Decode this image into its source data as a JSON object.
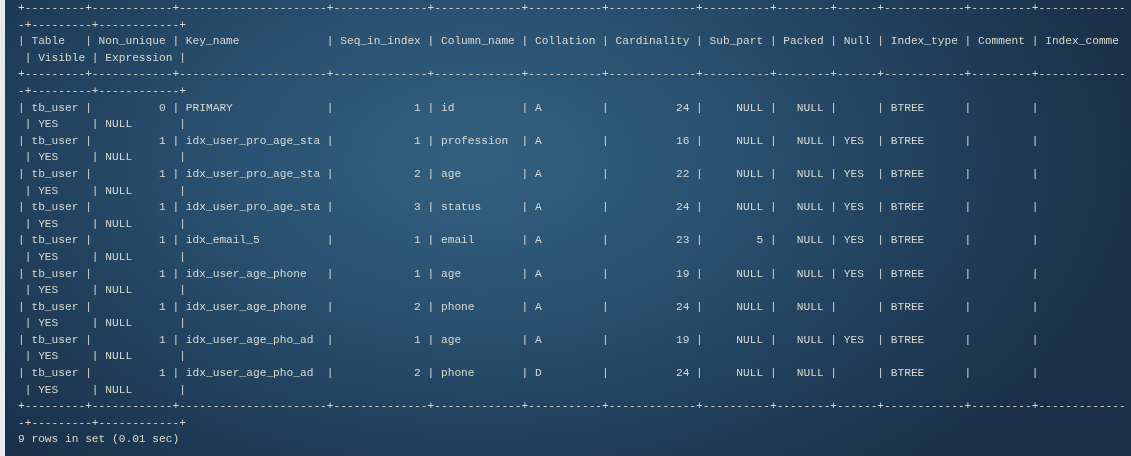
{
  "terminal": {
    "lines": [
      "+---------+------------+----------------------+--------------+-------------+-----------+-------------+----------+--------+------+------------+---------+-------------",
      "-+---------+------------+",
      "| Table   | Non_unique | Key_name             | Seq_in_index | Column_name | Collation | Cardinality | Sub_part | Packed | Null | Index_type | Comment | Index_comme",
      " | Visible | Expression |",
      "+---------+------------+----------------------+--------------+-------------+-----------+-------------+----------+--------+------+------------+---------+-------------",
      "-+---------+------------+",
      "| tb_user |          0 | PRIMARY              |            1 | id          | A         |          24 |     NULL |   NULL |      | BTREE      |         |",
      " | YES     | NULL       |",
      "| tb_user |          1 | idx_user_pro_age_sta |            1 | profession  | A         |          16 |     NULL |   NULL | YES  | BTREE      |         |",
      " | YES     | NULL       |",
      "| tb_user |          1 | idx_user_pro_age_sta |            2 | age         | A         |          22 |     NULL |   NULL | YES  | BTREE      |         |",
      " | YES     | NULL       |",
      "| tb_user |          1 | idx_user_pro_age_sta |            3 | status      | A         |          24 |     NULL |   NULL | YES  | BTREE      |         |",
      " | YES     | NULL       |",
      "| tb_user |          1 | idx_email_5          |            1 | email       | A         |          23 |        5 |   NULL | YES  | BTREE      |         |",
      " | YES     | NULL       |",
      "| tb_user |          1 | idx_user_age_phone   |            1 | age         | A         |          19 |     NULL |   NULL | YES  | BTREE      |         |",
      " | YES     | NULL       |",
      "| tb_user |          1 | idx_user_age_phone   |            2 | phone       | A         |          24 |     NULL |   NULL |      | BTREE      |         |",
      " | YES     | NULL       |",
      "| tb_user |          1 | idx_user_age_pho_ad  |            1 | age         | A         |          19 |     NULL |   NULL | YES  | BTREE      |         |",
      " | YES     | NULL       |",
      "| tb_user |          1 | idx_user_age_pho_ad  |            2 | phone       | D         |          24 |     NULL |   NULL |      | BTREE      |         |",
      " | YES     | NULL       |",
      "+---------+------------+----------------------+--------------+-------------+-----------+-------------+----------+--------+------+------------+---------+-------------",
      "-+---------+------------+",
      "9 rows in set (0.01 sec)"
    ]
  }
}
